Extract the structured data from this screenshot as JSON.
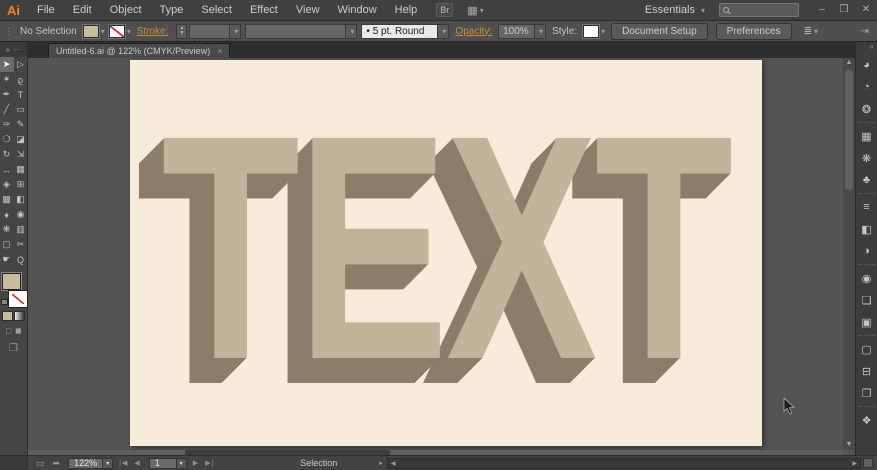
{
  "app": {
    "logo": "Ai",
    "menu": [
      "File",
      "Edit",
      "Object",
      "Type",
      "Select",
      "Effect",
      "View",
      "Window",
      "Help"
    ],
    "br_button": "Br",
    "workspace_label": "Essentials",
    "search_placeholder": "",
    "window": {
      "minimize": "–",
      "restore": "❐",
      "close": "✕"
    }
  },
  "control_bar": {
    "selection_status": "No Selection",
    "stroke_label": "Stroke:",
    "brush_value": "5 pt. Round",
    "brush_bullet": "•",
    "opacity_label": "Opacity:",
    "opacity_value": "100%",
    "style_label": "Style:",
    "document_setup_button": "Document Setup",
    "preferences_button": "Preferences"
  },
  "tab": {
    "title": "Untitled-6.ai @ 122% (CMYK/Preview)",
    "close": "×"
  },
  "artboard": {
    "word": "TEXT"
  },
  "status_bar": {
    "zoom": "122%",
    "artboard_number": "1",
    "status": "Selection"
  },
  "colors": {
    "logo_orange": "#ff7f1e",
    "accent_link": "#cd9039",
    "fill_swatch": "#c9bc9c",
    "artboard_bg": "#f7ecd9",
    "letter_face": "#c1b49b",
    "letter_extrude": "#8c7d6a"
  },
  "icons": {
    "grip": "⋮",
    "collapse": "«",
    "dots": "⋯",
    "caret": "▾",
    "step_up": "▲",
    "step_down": "▼",
    "workspace_grid": "▦",
    "align": "≣",
    "panel_collapse": "⇥",
    "screen": "▭",
    "share": "➦",
    "nav_first": "|◀",
    "nav_prev": "◀",
    "nav_next": "▶",
    "nav_last": "▶|",
    "status_flyout": "▸",
    "scroll_up": "▲",
    "scroll_down": "▼",
    "scroll_left": "◀",
    "scroll_right": "▶",
    "draw_normal": "◻",
    "draw_behind": "◼",
    "screen_mode": "❐"
  },
  "tools": [
    {
      "name": "selection-tool",
      "glyph": "➤"
    },
    {
      "name": "direct-selection-tool",
      "glyph": "▷"
    },
    {
      "name": "magic-wand-tool",
      "glyph": "✶"
    },
    {
      "name": "lasso-tool",
      "glyph": "ϱ"
    },
    {
      "name": "pen-tool",
      "glyph": "✒"
    },
    {
      "name": "type-tool",
      "glyph": "T"
    },
    {
      "name": "line-segment-tool",
      "glyph": "╱"
    },
    {
      "name": "rectangle-tool",
      "glyph": "▭"
    },
    {
      "name": "paintbrush-tool",
      "glyph": "✑"
    },
    {
      "name": "pencil-tool",
      "glyph": "✎"
    },
    {
      "name": "blob-brush-tool",
      "glyph": "❍"
    },
    {
      "name": "eraser-tool",
      "glyph": "◪"
    },
    {
      "name": "rotate-tool",
      "glyph": "↻"
    },
    {
      "name": "scale-tool",
      "glyph": "⇲"
    },
    {
      "name": "width-tool",
      "glyph": "↔"
    },
    {
      "name": "free-transform-tool",
      "glyph": "▦"
    },
    {
      "name": "shape-builder-tool",
      "glyph": "◈"
    },
    {
      "name": "perspective-grid-tool",
      "glyph": "⊞"
    },
    {
      "name": "mesh-tool",
      "glyph": "▩"
    },
    {
      "name": "gradient-tool",
      "glyph": "◧"
    },
    {
      "name": "eyedropper-tool",
      "glyph": "♦"
    },
    {
      "name": "blend-tool",
      "glyph": "◉"
    },
    {
      "name": "symbol-sprayer-tool",
      "glyph": "❋"
    },
    {
      "name": "column-graph-tool",
      "glyph": "▥"
    },
    {
      "name": "artboard-tool",
      "glyph": "▢"
    },
    {
      "name": "slice-tool",
      "glyph": "✂"
    },
    {
      "name": "hand-tool",
      "glyph": "☛"
    },
    {
      "name": "zoom-tool",
      "glyph": "Q"
    }
  ],
  "panels": [
    {
      "name": "color-panel",
      "glyph": "◕"
    },
    {
      "name": "color-guide-panel",
      "glyph": "◔"
    },
    {
      "name": "kuler-panel",
      "glyph": "❂"
    },
    {
      "name": "swatches-panel",
      "glyph": "▦"
    },
    {
      "name": "symbols-panel",
      "glyph": "❋"
    },
    {
      "name": "brushes-panel",
      "glyph": "♣"
    },
    {
      "name": "stroke-panel",
      "glyph": "≡"
    },
    {
      "name": "gradient-panel",
      "glyph": "◧"
    },
    {
      "name": "transparency-panel",
      "glyph": "◑"
    },
    {
      "name": "appearance-panel",
      "glyph": "◉"
    },
    {
      "name": "graphic-styles-panel",
      "glyph": "❏"
    },
    {
      "name": "pathfinder-panel",
      "glyph": "▣"
    },
    {
      "name": "transform-panel",
      "glyph": "▢"
    },
    {
      "name": "align-panel",
      "glyph": "⊟"
    },
    {
      "name": "artboards-panel",
      "glyph": "❐"
    },
    {
      "name": "layers-panel",
      "glyph": "❖"
    }
  ]
}
